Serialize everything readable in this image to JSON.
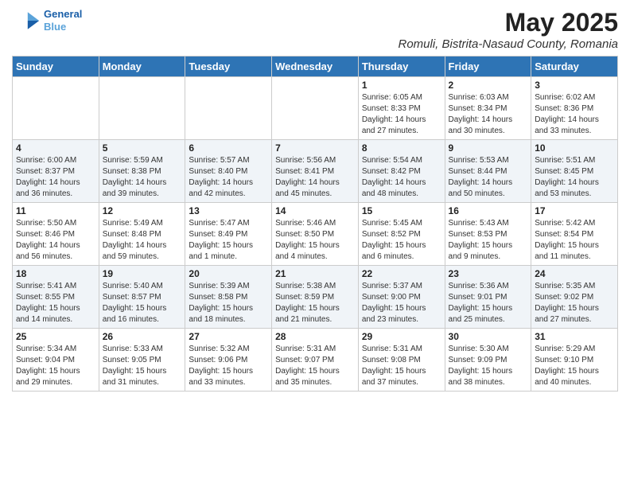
{
  "header": {
    "logo_line1": "General",
    "logo_line2": "Blue",
    "month_year": "May 2025",
    "location": "Romuli, Bistrita-Nasaud County, Romania"
  },
  "weekdays": [
    "Sunday",
    "Monday",
    "Tuesday",
    "Wednesday",
    "Thursday",
    "Friday",
    "Saturday"
  ],
  "weeks": [
    [
      {
        "day": "",
        "info": ""
      },
      {
        "day": "",
        "info": ""
      },
      {
        "day": "",
        "info": ""
      },
      {
        "day": "",
        "info": ""
      },
      {
        "day": "1",
        "info": "Sunrise: 6:05 AM\nSunset: 8:33 PM\nDaylight: 14 hours\nand 27 minutes."
      },
      {
        "day": "2",
        "info": "Sunrise: 6:03 AM\nSunset: 8:34 PM\nDaylight: 14 hours\nand 30 minutes."
      },
      {
        "day": "3",
        "info": "Sunrise: 6:02 AM\nSunset: 8:36 PM\nDaylight: 14 hours\nand 33 minutes."
      }
    ],
    [
      {
        "day": "4",
        "info": "Sunrise: 6:00 AM\nSunset: 8:37 PM\nDaylight: 14 hours\nand 36 minutes."
      },
      {
        "day": "5",
        "info": "Sunrise: 5:59 AM\nSunset: 8:38 PM\nDaylight: 14 hours\nand 39 minutes."
      },
      {
        "day": "6",
        "info": "Sunrise: 5:57 AM\nSunset: 8:40 PM\nDaylight: 14 hours\nand 42 minutes."
      },
      {
        "day": "7",
        "info": "Sunrise: 5:56 AM\nSunset: 8:41 PM\nDaylight: 14 hours\nand 45 minutes."
      },
      {
        "day": "8",
        "info": "Sunrise: 5:54 AM\nSunset: 8:42 PM\nDaylight: 14 hours\nand 48 minutes."
      },
      {
        "day": "9",
        "info": "Sunrise: 5:53 AM\nSunset: 8:44 PM\nDaylight: 14 hours\nand 50 minutes."
      },
      {
        "day": "10",
        "info": "Sunrise: 5:51 AM\nSunset: 8:45 PM\nDaylight: 14 hours\nand 53 minutes."
      }
    ],
    [
      {
        "day": "11",
        "info": "Sunrise: 5:50 AM\nSunset: 8:46 PM\nDaylight: 14 hours\nand 56 minutes."
      },
      {
        "day": "12",
        "info": "Sunrise: 5:49 AM\nSunset: 8:48 PM\nDaylight: 14 hours\nand 59 minutes."
      },
      {
        "day": "13",
        "info": "Sunrise: 5:47 AM\nSunset: 8:49 PM\nDaylight: 15 hours\nand 1 minute."
      },
      {
        "day": "14",
        "info": "Sunrise: 5:46 AM\nSunset: 8:50 PM\nDaylight: 15 hours\nand 4 minutes."
      },
      {
        "day": "15",
        "info": "Sunrise: 5:45 AM\nSunset: 8:52 PM\nDaylight: 15 hours\nand 6 minutes."
      },
      {
        "day": "16",
        "info": "Sunrise: 5:43 AM\nSunset: 8:53 PM\nDaylight: 15 hours\nand 9 minutes."
      },
      {
        "day": "17",
        "info": "Sunrise: 5:42 AM\nSunset: 8:54 PM\nDaylight: 15 hours\nand 11 minutes."
      }
    ],
    [
      {
        "day": "18",
        "info": "Sunrise: 5:41 AM\nSunset: 8:55 PM\nDaylight: 15 hours\nand 14 minutes."
      },
      {
        "day": "19",
        "info": "Sunrise: 5:40 AM\nSunset: 8:57 PM\nDaylight: 15 hours\nand 16 minutes."
      },
      {
        "day": "20",
        "info": "Sunrise: 5:39 AM\nSunset: 8:58 PM\nDaylight: 15 hours\nand 18 minutes."
      },
      {
        "day": "21",
        "info": "Sunrise: 5:38 AM\nSunset: 8:59 PM\nDaylight: 15 hours\nand 21 minutes."
      },
      {
        "day": "22",
        "info": "Sunrise: 5:37 AM\nSunset: 9:00 PM\nDaylight: 15 hours\nand 23 minutes."
      },
      {
        "day": "23",
        "info": "Sunrise: 5:36 AM\nSunset: 9:01 PM\nDaylight: 15 hours\nand 25 minutes."
      },
      {
        "day": "24",
        "info": "Sunrise: 5:35 AM\nSunset: 9:02 PM\nDaylight: 15 hours\nand 27 minutes."
      }
    ],
    [
      {
        "day": "25",
        "info": "Sunrise: 5:34 AM\nSunset: 9:04 PM\nDaylight: 15 hours\nand 29 minutes."
      },
      {
        "day": "26",
        "info": "Sunrise: 5:33 AM\nSunset: 9:05 PM\nDaylight: 15 hours\nand 31 minutes."
      },
      {
        "day": "27",
        "info": "Sunrise: 5:32 AM\nSunset: 9:06 PM\nDaylight: 15 hours\nand 33 minutes."
      },
      {
        "day": "28",
        "info": "Sunrise: 5:31 AM\nSunset: 9:07 PM\nDaylight: 15 hours\nand 35 minutes."
      },
      {
        "day": "29",
        "info": "Sunrise: 5:31 AM\nSunset: 9:08 PM\nDaylight: 15 hours\nand 37 minutes."
      },
      {
        "day": "30",
        "info": "Sunrise: 5:30 AM\nSunset: 9:09 PM\nDaylight: 15 hours\nand 38 minutes."
      },
      {
        "day": "31",
        "info": "Sunrise: 5:29 AM\nSunset: 9:10 PM\nDaylight: 15 hours\nand 40 minutes."
      }
    ]
  ]
}
